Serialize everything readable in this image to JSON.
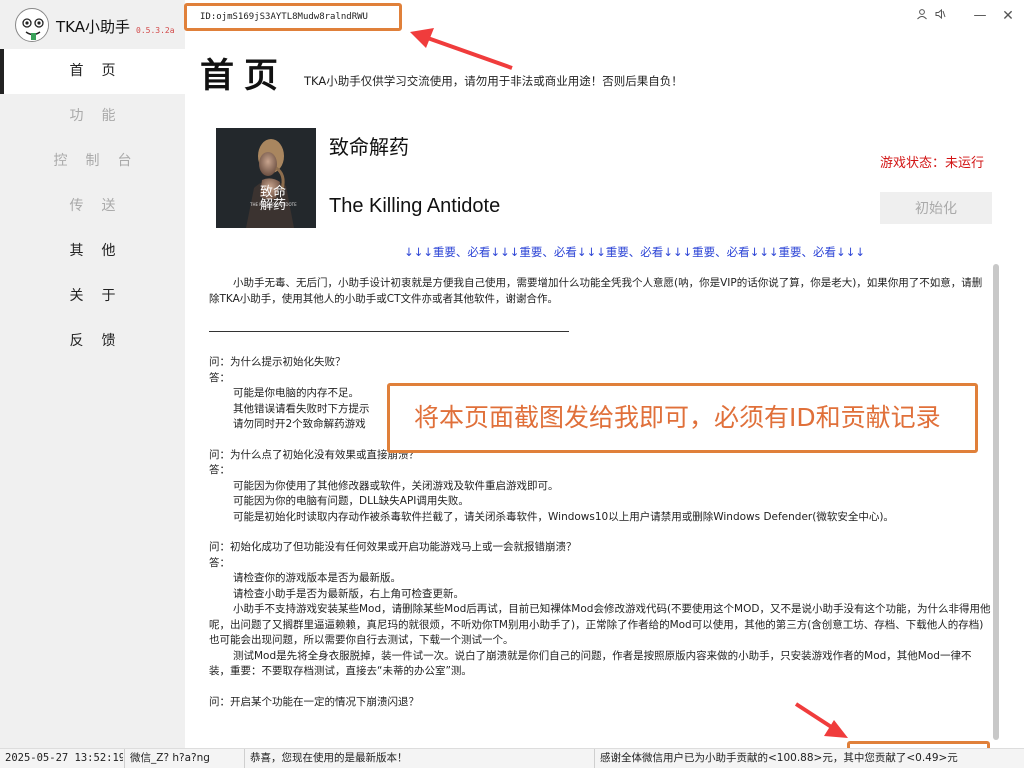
{
  "app": {
    "name": "TKA小助手",
    "version": "0.5.3.2a"
  },
  "id_label": "ID:ojmS169jS3AYTL8Mudw8ralndRWU",
  "window_controls": {
    "user_icon": "user-icon",
    "sound_icon": "speaker-icon",
    "minimize": "—",
    "close": "✕"
  },
  "sidebar": {
    "items": [
      {
        "label": "首页",
        "state": "active"
      },
      {
        "label": "功能",
        "state": "disabled"
      },
      {
        "label": "控制台",
        "state": "disabled"
      },
      {
        "label": "传送",
        "state": "disabled"
      },
      {
        "label": "其他",
        "state": "normal"
      },
      {
        "label": "关于",
        "state": "normal"
      },
      {
        "label": "反馈",
        "state": "normal"
      }
    ]
  },
  "page": {
    "title": "首页",
    "disclaimer": "TKA小助手仅供学习交流使用，请勿用于非法或商业用途！否则后果自负！"
  },
  "game": {
    "name_cn": "致命解药",
    "name_en": "The Killing Antidote",
    "cover_text_cn": "致命 解药",
    "cover_text_en": "THE KILLING ANTIDOTE",
    "status_label": "游戏状态：未运行",
    "init_button": "初始化"
  },
  "notice_line": "↓↓↓重要、必看↓↓↓重要、必看↓↓↓重要、必看↓↓↓重要、必看↓↓↓重要、必看↓↓↓",
  "content": {
    "intro": "小助手无毒、无后门，小助手设计初衷就是方便我自己使用，需要增加什么功能全凭我个人意愿(呐，你是VIP的话你说了算，你是老大)，如果你用了不如意，请删除TKA小助手，使用其他人的小助手或CT文件亦或者其他软件，谢谢合作。",
    "faq": [
      {
        "q": "问：为什么提示初始化失败？",
        "a_label": "答：",
        "a": [
          "可能是你电脑的内存不足。",
          "其他错误请看失败时下方提示",
          "请勿同时开2个致命解药游戏"
        ]
      },
      {
        "q": "问：为什么点了初始化没有效果或直接崩溃？",
        "a_label": "答：",
        "a": [
          "可能因为你使用了其他修改器或软件，关闭游戏及软件重启游戏即可。",
          "可能因为你的电脑有问题，DLL缺失API调用失败。",
          "可能是初始化时读取内存动作被杀毒软件拦截了，请关闭杀毒软件，Windows10以上用户请禁用或删除Windows Defender(微软安全中心)。"
        ]
      },
      {
        "q": "问：初始化成功了但功能没有任何效果或开启功能游戏马上或一会就报错崩溃？",
        "a_label": "答：",
        "a": [
          "请检查你的游戏版本是否为最新版。",
          "请检查小助手是否为最新版，右上角可检查更新。",
          "小助手不支持游戏安装某些Mod，请删除某些Mod后再试，目前已知裸体Mod会修改游戏代码(不要使用这个MOD，又不是说小助手没有这个功能，为什么非得用他呢，出问题了又搁群里逼逼赖赖，真尼玛的就很烦，不听劝你TM别用小助手了)，正常除了作者给的Mod可以使用，其他的第三方(含创意工坊、存档、下载他人的存档)也可能会出现问题，所以需要你自行去测试，下载一个测试一个。",
          "测试Mod是先将全身衣服脱掉，装一件试一次。说白了崩溃就是你们自己的问题，作者是按照原版内容来做的小助手，只安装游戏作者的Mod，其他Mod一律不装，重要：不要取存档测试，直接去“未蒂的办公室”测。"
        ]
      },
      {
        "q": "问：开启某个功能在一定的情况下崩溃闪退？",
        "a_label": "",
        "a": []
      }
    ]
  },
  "callout": "将本页面截图发给我即可，必须有ID和贡献记录",
  "statusbar": {
    "datetime": "2025-05-27 13:52:19",
    "wechat": "微信_Z? h?a?ng",
    "update": "恭喜，您现在使用的是最新版本！",
    "donation": "感谢全体微信用户已为小助手贡献的<100.88>元，其中您贡献了<0.49>元"
  },
  "colors": {
    "accent_orange": "#e0803a",
    "status_red": "#d21414",
    "notice_blue": "#2d45d6"
  }
}
